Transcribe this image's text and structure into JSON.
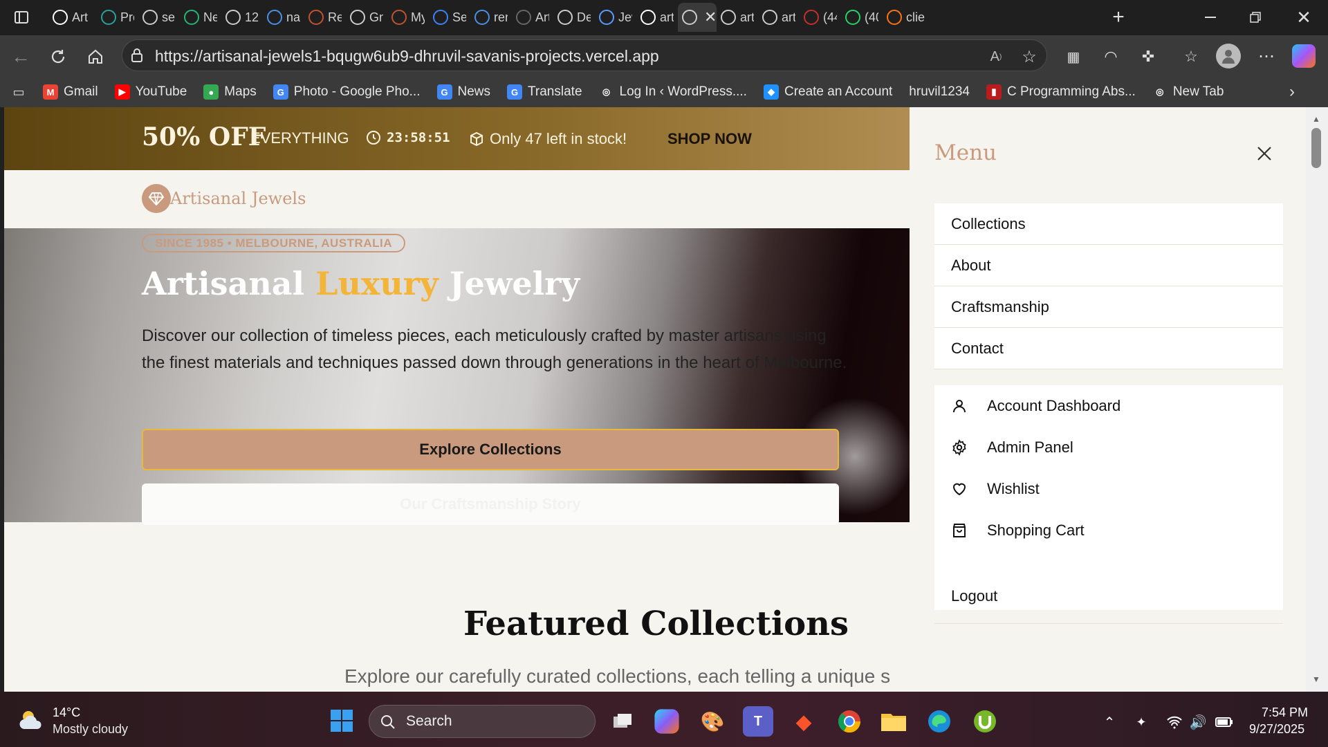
{
  "browser": {
    "tabs": [
      {
        "title": "Art",
        "icon": "github-icon",
        "color": "#ffffff"
      },
      {
        "title": "Pro",
        "icon": "diamond-icon",
        "color": "#2aa198"
      },
      {
        "title": "ser",
        "icon": "globe-icon",
        "color": "#cccccc"
      },
      {
        "title": "Ne",
        "icon": "n-logo-icon",
        "color": "#22b573"
      },
      {
        "title": "12",
        "icon": "globe-icon",
        "color": "#cccccc"
      },
      {
        "title": "nar",
        "icon": "search-icon",
        "color": "#4a90e2"
      },
      {
        "title": "Res",
        "icon": "w-logo-icon",
        "color": "#c0522d"
      },
      {
        "title": "Gn",
        "icon": "google-icon",
        "color": "#cccccc"
      },
      {
        "title": "My",
        "icon": "w-logo-icon",
        "color": "#c0522d"
      },
      {
        "title": "Se",
        "icon": "blocks-icon",
        "color": "#3b82f6"
      },
      {
        "title": "rer",
        "icon": "search-icon",
        "color": "#4a90e2"
      },
      {
        "title": "Art",
        "icon": "check-app-icon",
        "color": "#666666"
      },
      {
        "title": "De",
        "icon": "openai-icon",
        "color": "#cccccc"
      },
      {
        "title": "Jew",
        "icon": "blue-pill-icon",
        "color": "#5b9bff"
      },
      {
        "title": "art",
        "icon": "vercel-icon",
        "color": "#ffffff"
      },
      {
        "title": "",
        "icon": "globe-icon",
        "color": "#cccccc"
      },
      {
        "title": "art",
        "icon": "globe-icon",
        "color": "#cccccc"
      },
      {
        "title": "art",
        "icon": "globe-icon",
        "color": "#cccccc"
      },
      {
        "title": "(44",
        "icon": "youtube-icon",
        "color": "#c4302b"
      },
      {
        "title": "(40",
        "icon": "whatsapp-icon",
        "color": "#25d366"
      },
      {
        "title": "clie",
        "icon": "tasks-icon",
        "color": "#f97316"
      }
    ],
    "url": "https://artisanal-jewels1-bqugw6ub9-dhruvil-savanis-projects.vercel.app",
    "bookmarks": [
      {
        "label": "Gmail",
        "icon": "gmail-icon",
        "color": "#ea4335",
        "glyph": "M"
      },
      {
        "label": "YouTube",
        "icon": "youtube-icon",
        "color": "#ff0000",
        "glyph": "▶"
      },
      {
        "label": "Maps",
        "icon": "maps-pin-icon",
        "color": "#34a853",
        "glyph": "●"
      },
      {
        "label": "Photo - Google Pho...",
        "icon": "google-icon",
        "color": "#4285f4",
        "glyph": "G"
      },
      {
        "label": "News",
        "icon": "google-news-icon",
        "color": "#4285f4",
        "glyph": "G"
      },
      {
        "label": "Translate",
        "icon": "translate-icon",
        "color": "#4285f4",
        "glyph": "G"
      },
      {
        "label": "Log In ‹ WordPress....",
        "icon": "globe-icon",
        "color": "#3a3a3a",
        "glyph": "◎"
      },
      {
        "label": "Create an Account",
        "icon": "cloud-icon",
        "color": "#1e90ff",
        "glyph": "◆"
      },
      {
        "label": "hruvil1234",
        "icon": "",
        "color": "#3a3a3a",
        "glyph": ""
      },
      {
        "label": "C Programming Abs...",
        "icon": "book-icon",
        "color": "#b91c1c",
        "glyph": "▮"
      },
      {
        "label": "New Tab",
        "icon": "globe-icon",
        "color": "#3a3a3a",
        "glyph": "◎"
      }
    ]
  },
  "promo": {
    "discount": "50% OFF",
    "scope": "EVERYTHING",
    "timer": "23:58:51",
    "stock": "Only 47 left in stock!",
    "cta": "SHOP NOW"
  },
  "site": {
    "logo_text": "Artisanal Jewels"
  },
  "hero": {
    "badge": "SINCE 1985 • MELBOURNE, AUSTRALIA",
    "title_part1": "Artisanal ",
    "title_highlight": "Luxury",
    "title_part2": " Jewelry",
    "description": "Discover our collection of timeless pieces, each meticulously crafted by master artisans using the finest materials and techniques passed down through generations in the heart of Melbourne.",
    "primary_button": "Explore Collections",
    "secondary_button": "Our Craftsmanship Story"
  },
  "featured": {
    "title": "Featured Collections",
    "subtitle": "Explore our carefully curated collections, each telling a unique s"
  },
  "menu": {
    "title": "Menu",
    "nav": [
      "Collections",
      "About",
      "Craftsmanship",
      "Contact"
    ],
    "account": [
      {
        "label": "Account Dashboard",
        "icon": "user-icon"
      },
      {
        "label": "Admin Panel",
        "icon": "gear-icon"
      },
      {
        "label": "Wishlist",
        "icon": "heart-icon"
      },
      {
        "label": "Shopping Cart",
        "icon": "shopping-bag-icon"
      }
    ],
    "logout": "Logout"
  },
  "taskbar": {
    "temperature": "14°C",
    "weather": "Mostly cloudy",
    "search_placeholder": "Search",
    "time": "7:54 PM",
    "date": "9/27/2025"
  },
  "colors": {
    "accent": "#c99a7e",
    "highlight": "#f3b43a",
    "promo_start": "#5c4410",
    "promo_end": "#b08d52"
  }
}
